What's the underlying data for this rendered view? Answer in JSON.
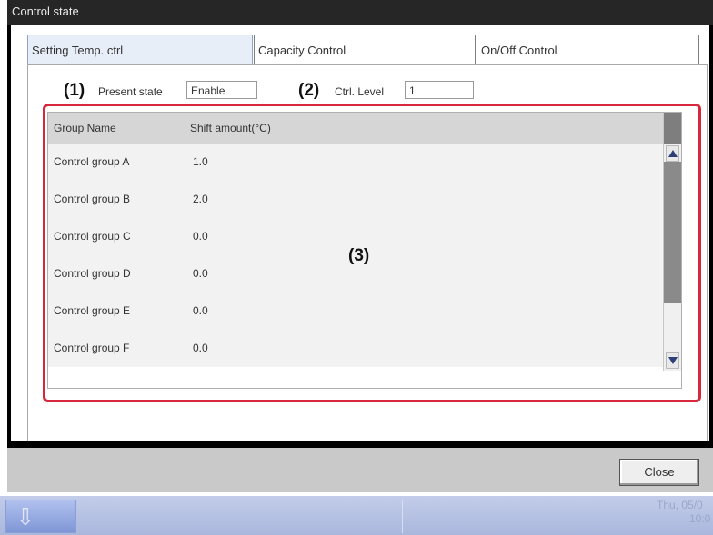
{
  "window": {
    "title": "Control state"
  },
  "tabs": [
    {
      "label": "Setting Temp. ctrl",
      "active": true
    },
    {
      "label": "Capacity Control",
      "active": false
    },
    {
      "label": "On/Off Control",
      "active": false
    }
  ],
  "annotations": {
    "one": "(1)",
    "two": "(2)",
    "three": "(3)"
  },
  "present_state": {
    "label": "Present state",
    "value": "Enable"
  },
  "ctrl_level": {
    "label": "Ctrl. Level",
    "value": "1"
  },
  "table": {
    "columns": [
      "Group Name",
      "Shift amount(°C)"
    ],
    "rows": [
      {
        "name": "Control group A",
        "shift": "1.0"
      },
      {
        "name": "Control group B",
        "shift": "2.0"
      },
      {
        "name": "Control group C",
        "shift": "0.0"
      },
      {
        "name": "Control group D",
        "shift": "0.0"
      },
      {
        "name": "Control group E",
        "shift": "0.0"
      },
      {
        "name": "Control group F",
        "shift": "0.0"
      }
    ]
  },
  "buttons": {
    "close": "Close"
  },
  "taskbar": {
    "button_label": "",
    "date": "Thu, 05/0",
    "time": "10:0"
  },
  "colors": {
    "accent_red": "#d6283a",
    "active_tab": "#e8eef8",
    "taskbar": "#aab7dc"
  },
  "icons": {
    "scroll_up": "triangle-up-icon",
    "scroll_down": "triangle-down-icon",
    "taskbar": "arrow-down-icon"
  }
}
